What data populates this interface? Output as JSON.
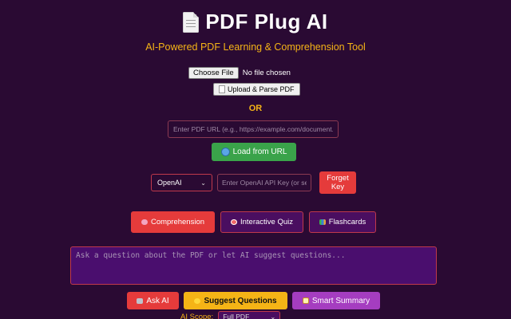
{
  "header": {
    "title": "PDF Plug AI",
    "title_icon": "document-icon",
    "subtitle": "AI-Powered PDF Learning & Comprehension Tool"
  },
  "file_upload": {
    "choose_label": "Choose File",
    "status": "No file chosen",
    "upload_label": "Upload & Parse PDF"
  },
  "divider": {
    "or_label": "OR"
  },
  "url_loader": {
    "placeholder": "Enter PDF URL (e.g., https://example.com/document.pdf)",
    "value": "",
    "load_label": "Load from URL",
    "load_color": "#3aa34a"
  },
  "api": {
    "provider": "OpenAI",
    "key_placeholder": "Enter OpenAI API Key (or set in .env)",
    "key_value": "",
    "forget_label": "Forget Key"
  },
  "tabs": [
    {
      "label": "Comprehension",
      "icon": "brain-icon",
      "active": true
    },
    {
      "label": "Interactive Quiz",
      "icon": "target-icon",
      "active": false
    },
    {
      "label": "Flashcards",
      "icon": "books-icon",
      "active": false
    }
  ],
  "question": {
    "placeholder": "Ask a question about the PDF or let AI suggest questions...",
    "value": ""
  },
  "actions": {
    "ask_label": "Ask AI",
    "suggest_label": "Suggest Questions",
    "summary_label": "Smart Summary"
  },
  "scope": {
    "label": "AI Scope:",
    "selected": "Full PDF"
  },
  "colors": {
    "background": "#2a0a33",
    "accent_yellow": "#f5b416",
    "accent_red": "#e53b3b",
    "accent_purple": "#a53dc0"
  }
}
